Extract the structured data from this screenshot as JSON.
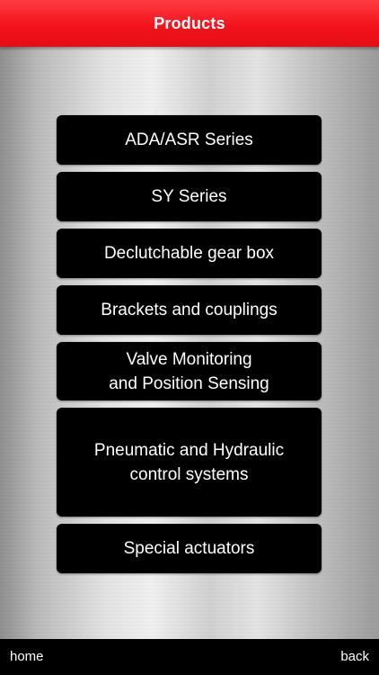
{
  "header": {
    "title": "Products"
  },
  "menu": {
    "items": [
      {
        "label": "ADA/ASR Series"
      },
      {
        "label": "SY Series"
      },
      {
        "label": "Declutchable gear box"
      },
      {
        "label": "Brackets and couplings"
      },
      {
        "label": "Valve Monitoring\nand Position Sensing"
      },
      {
        "label": "Pneumatic and Hydraulic\ncontrol systems"
      },
      {
        "label": "Special actuators"
      }
    ]
  },
  "footer": {
    "home_label": "home",
    "back_label": "back"
  },
  "colors": {
    "header_red": "#f3131c",
    "button_black": "#000000",
    "text_white": "#ffffff"
  }
}
